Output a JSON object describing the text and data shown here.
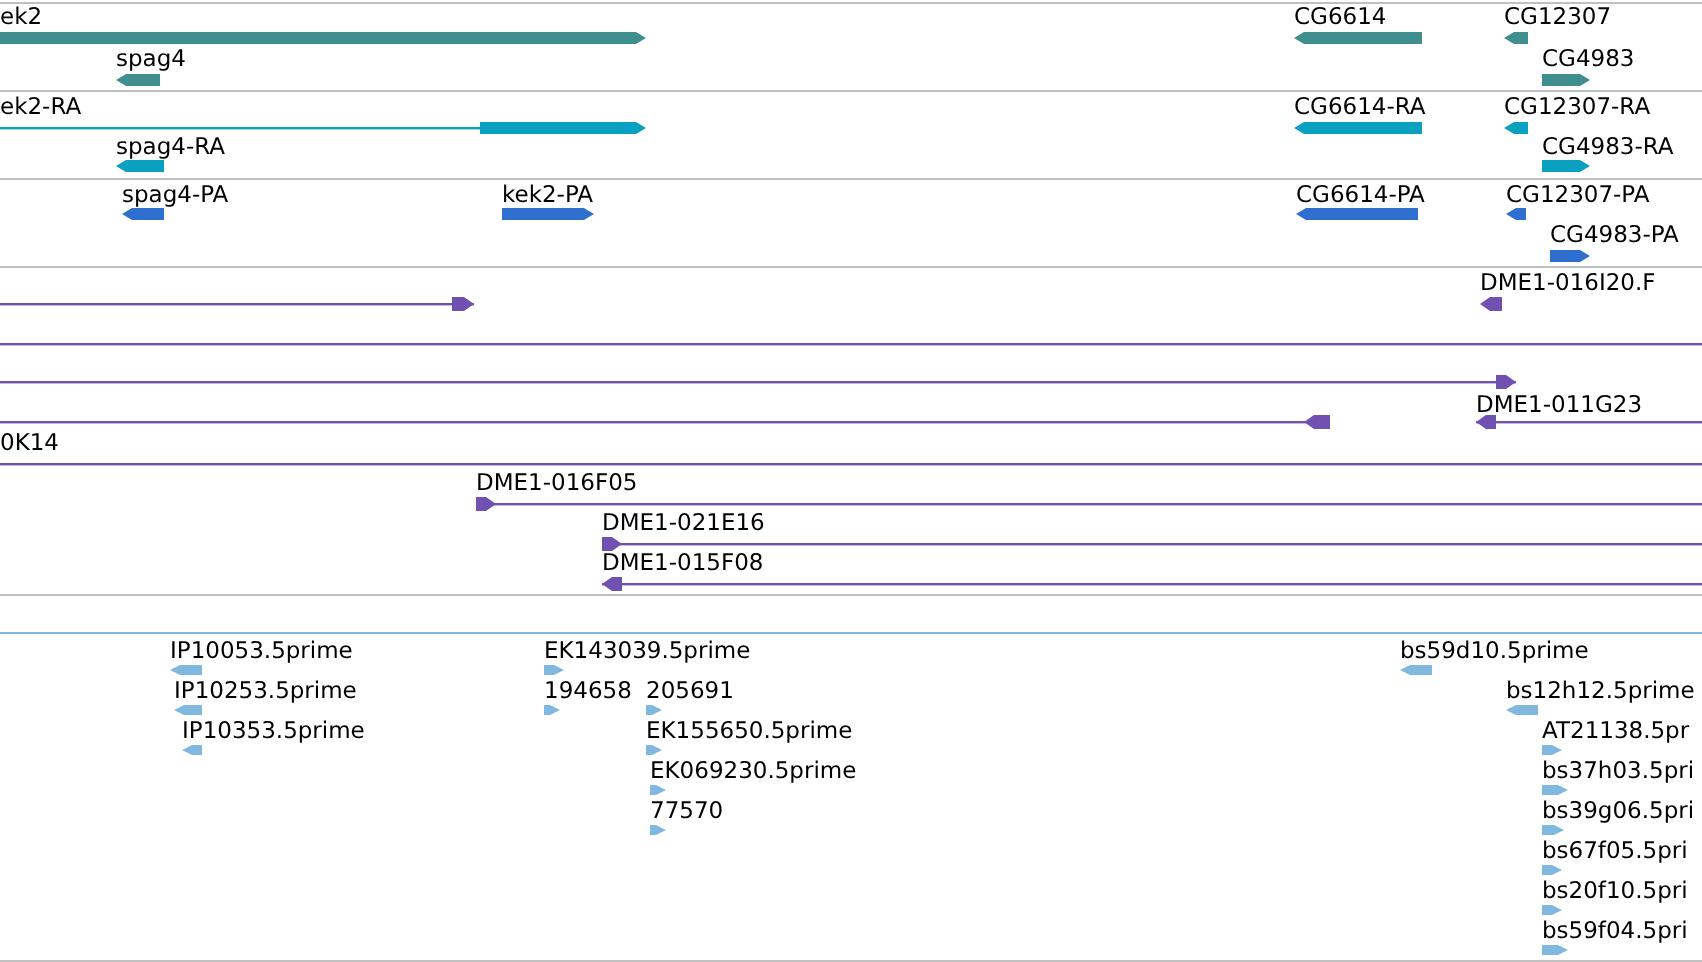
{
  "tracks": [
    {
      "kind": "gene",
      "color": "#3f8f8f",
      "features": [
        {
          "label": "ek2",
          "reverse": false
        },
        {
          "label": "spag4",
          "reverse": true
        },
        {
          "label": "CG6614",
          "reverse": true
        },
        {
          "label": "CG12307",
          "reverse": true
        },
        {
          "label": "CG4983",
          "reverse": false
        }
      ]
    },
    {
      "kind": "transcript",
      "color": "#0aa0c0",
      "features": [
        {
          "label": "ek2-RA",
          "reverse": false
        },
        {
          "label": "spag4-RA",
          "reverse": true
        },
        {
          "label": "CG6614-RA",
          "reverse": true
        },
        {
          "label": "CG12307-RA",
          "reverse": true
        },
        {
          "label": "CG4983-RA",
          "reverse": false
        }
      ]
    },
    {
      "kind": "protein",
      "color": "#2f6fcf",
      "features": [
        {
          "label": "spag4-PA",
          "reverse": true
        },
        {
          "label": "kek2-PA",
          "reverse": false
        },
        {
          "label": "CG6614-PA",
          "reverse": true
        },
        {
          "label": "CG12307-PA",
          "reverse": true
        },
        {
          "label": "CG4983-PA",
          "reverse": false
        }
      ]
    },
    {
      "kind": "clone",
      "color": "#7050b0",
      "features": [
        {
          "kind": "arrow",
          "reverse": false
        },
        {
          "kind": "arrow",
          "label": "DME1-016I20.F",
          "reverse": true
        },
        {
          "kind": "plain"
        },
        {
          "kind": "arrow",
          "reverse": false
        },
        {
          "kind": "arrow",
          "reverse": true
        },
        {
          "kind": "arrow",
          "label": "DME1-011G23",
          "reverse": true
        },
        {
          "kind": "plain",
          "label": "0K14"
        },
        {
          "kind": "arrow",
          "label": "DME1-016F05",
          "reverse": false
        },
        {
          "kind": "arrow",
          "label": "DME1-021E16",
          "reverse": false
        },
        {
          "kind": "arrow",
          "label": "DME1-015F08",
          "reverse": true
        }
      ]
    },
    {
      "kind": "est",
      "color": "#80b8e0",
      "features": [
        {
          "label": "IP10053.5prime",
          "reverse": true
        },
        {
          "label": "IP10253.5prime",
          "reverse": true
        },
        {
          "label": "IP10353.5prime",
          "reverse": true
        },
        {
          "label": "EK143039.5prime",
          "reverse": false
        },
        {
          "label": "194658",
          "reverse": false
        },
        {
          "label": "205691",
          "reverse": false
        },
        {
          "label": "EK155650.5prime",
          "reverse": false
        },
        {
          "label": "EK069230.5prime",
          "reverse": false
        },
        {
          "label": "77570",
          "reverse": false
        },
        {
          "label": "bs59d10.5prime",
          "reverse": true
        },
        {
          "label": "bs12h12.5prime",
          "reverse": true
        },
        {
          "label": "AT21138.5pr",
          "reverse": false
        },
        {
          "label": "bs37h03.5pri",
          "reverse": false
        },
        {
          "label": "bs39g06.5pri",
          "reverse": false
        },
        {
          "label": "bs67f05.5pri",
          "reverse": false
        },
        {
          "label": "bs20f10.5pri",
          "reverse": false
        },
        {
          "label": "bs59f04.5pri",
          "reverse": false
        }
      ]
    }
  ]
}
